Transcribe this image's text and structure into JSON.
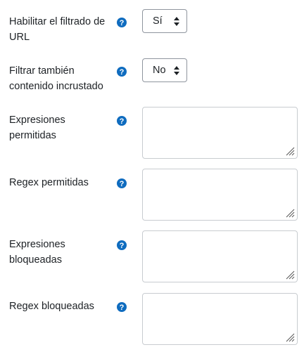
{
  "settings": {
    "url_filtering": {
      "label": "Habilitar el filtrado de URL",
      "value": "Sí"
    },
    "embedded_filtering": {
      "label": "Filtrar también contenido incrustado",
      "value": "No"
    },
    "allowed_expressions": {
      "label": "Expresiones permitidas",
      "value": ""
    },
    "allowed_regex": {
      "label": "Regex permitidas",
      "value": ""
    },
    "blocked_expressions": {
      "label": "Expresiones bloqueadas",
      "value": ""
    },
    "blocked_regex": {
      "label": "Regex bloqueadas",
      "value": ""
    }
  },
  "icons": {
    "help": "question-circle-icon",
    "select": "sort-arrows-icon",
    "resize": "resize-grip-icon"
  },
  "colors": {
    "help_icon": "#0f6cbf",
    "text": "#1d2125",
    "select_border": "#8f959e",
    "textarea_border": "#c8ccd0"
  }
}
